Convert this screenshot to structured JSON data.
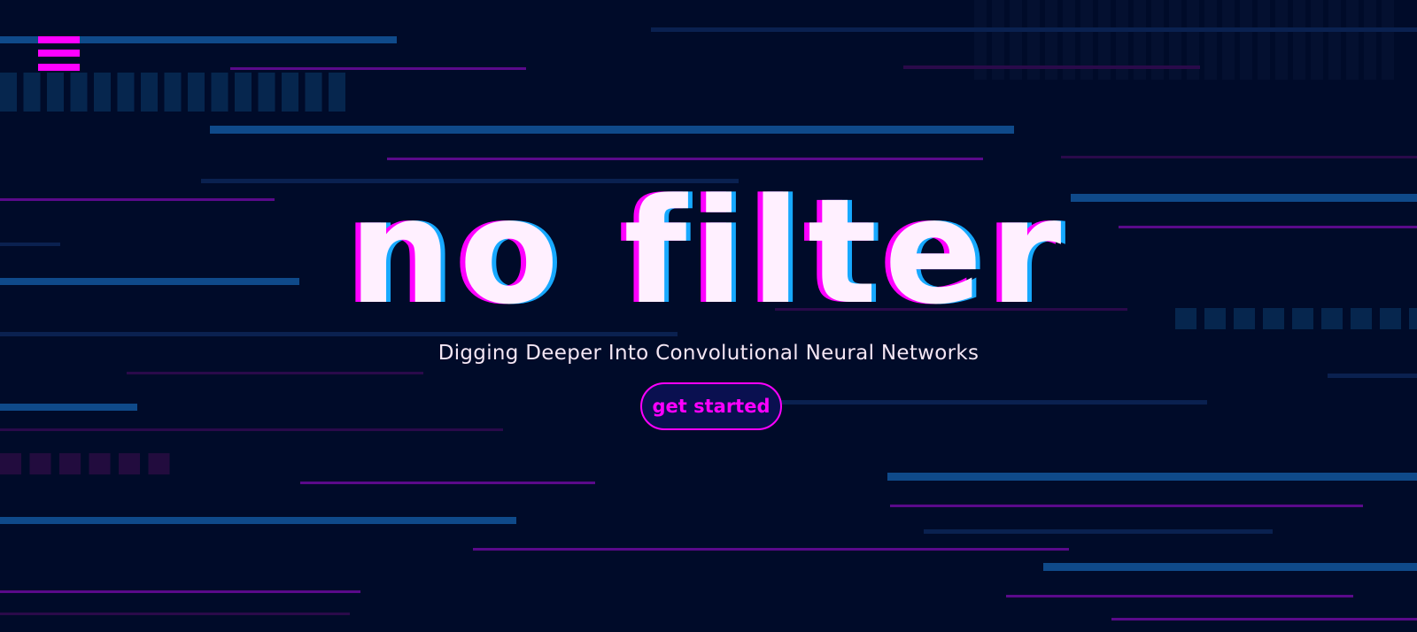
{
  "page": {
    "background_color": "#000b29"
  },
  "menu": {
    "icon": "hamburger-menu-icon",
    "color": "#ff00ff"
  },
  "hero": {
    "title": "no filter",
    "subtitle": "Digging Deeper Into Convolutional Neural Networks",
    "cta_label": "get started",
    "title_color": "#fff0ff",
    "title_shadow_colors": [
      "#ff00ff",
      "#17a9ff"
    ]
  },
  "theme": {
    "accent_magenta": "#ff00ff",
    "accent_blue": "#0f4a8a",
    "line_purple": "#5a0a8a"
  }
}
